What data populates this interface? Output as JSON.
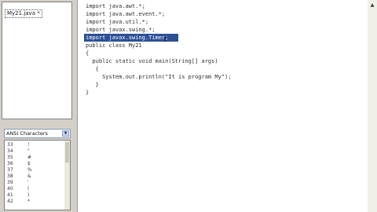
{
  "file_tree": {
    "items": [
      {
        "label": "My21.java *"
      }
    ]
  },
  "charset_panel": {
    "selected_charset": "ANSI Characters",
    "rows": [
      {
        "code": "33",
        "glyph": "!"
      },
      {
        "code": "34",
        "glyph": "\""
      },
      {
        "code": "35",
        "glyph": "#"
      },
      {
        "code": "36",
        "glyph": "$"
      },
      {
        "code": "37",
        "glyph": "%"
      },
      {
        "code": "38",
        "glyph": "&"
      },
      {
        "code": "39",
        "glyph": "'"
      },
      {
        "code": "40",
        "glyph": "("
      },
      {
        "code": "41",
        "glyph": ")"
      },
      {
        "code": "42",
        "glyph": "*"
      }
    ]
  },
  "editor": {
    "lines": [
      "import java.awt.*;",
      "import java.awt.event.*;",
      "import java.util.*;",
      "import javax.swing.*;",
      "import javax.swing.Timer;",
      "public class My21",
      "{",
      "  public static void main(String[] args)",
      "   {",
      "     System.out.println(\"It is program My\");",
      "   }",
      "}"
    ],
    "selected_line_index": 4
  },
  "colors": {
    "selection": "#2c4f96",
    "panel_bg": "#d4d0c8"
  }
}
